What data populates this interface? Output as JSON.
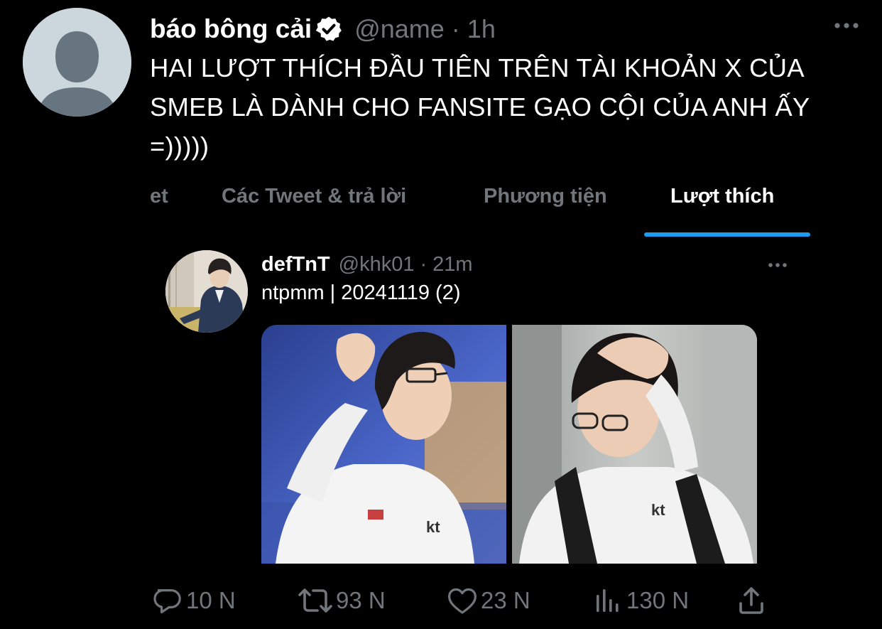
{
  "outer_tweet": {
    "display_name": "báo bông cải",
    "handle": "@name",
    "separator": "·",
    "time": "1h",
    "text": "HAI LƯỢT THÍCH ĐẦU TIÊN TRÊN TÀI KHOẢN X CỦA SMEB LÀ DÀNH CHO FANSITE GẠO CỘI CỦA ANH ẤY =)))))"
  },
  "tabs": [
    {
      "label": "et",
      "active": false
    },
    {
      "label": "Các Tweet & trả lời",
      "active": false
    },
    {
      "label": "Phương tiện",
      "active": false
    },
    {
      "label": "Lượt thích",
      "active": true
    }
  ],
  "inner_tweet": {
    "display_name": "defTnT",
    "handle": "@khk01",
    "separator": "·",
    "time": "21m",
    "text": "ntpmm | 20241119 (2)"
  },
  "actions": {
    "replies": "10 N",
    "retweets": "93 N",
    "likes": "23 N",
    "views": "130 N"
  },
  "colors": {
    "background": "#000000",
    "accent": "#1d9bf0",
    "muted": "#71767b",
    "text": "#ffffff"
  },
  "icons": {
    "verified": "verified-badge-icon",
    "more": "more-dots-icon",
    "reply": "reply-bubble-icon",
    "retweet": "retweet-arrows-icon",
    "like": "heart-icon",
    "views": "bar-chart-icon",
    "share": "share-upload-icon"
  }
}
